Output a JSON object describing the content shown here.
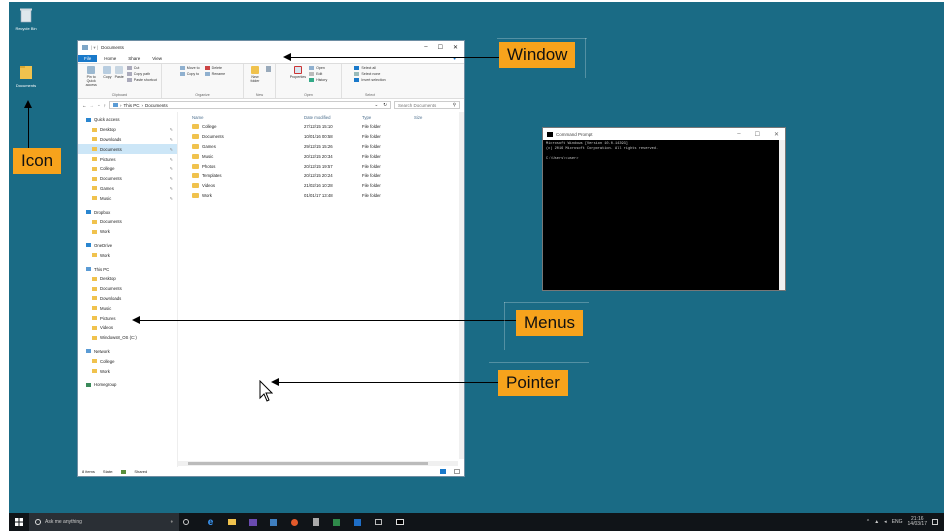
{
  "desktop": {
    "icons": [
      {
        "label": "Recycle Bin",
        "icon": "recycle-bin-icon"
      },
      {
        "label": "Documents",
        "icon": "folder-icon"
      }
    ]
  },
  "callouts": {
    "window": "Window",
    "icon": "Icon",
    "menus": "Menus",
    "pointer": "Pointer"
  },
  "explorer": {
    "title": "Documents",
    "tabs": [
      "File",
      "Home",
      "Share",
      "View"
    ],
    "ribbon": {
      "clipboard": {
        "label": "Clipboard",
        "pin": "Pin to Quick access",
        "copy": "Copy",
        "paste": "Paste",
        "cut": "Cut",
        "copy_path": "Copy path",
        "paste_shortcut": "Paste shortcut"
      },
      "organize": {
        "label": "Organize",
        "move_to": "Move to",
        "delete": "Delete",
        "copy_to": "Copy to",
        "rename": "Rename"
      },
      "new": {
        "label": "New",
        "new_folder": "New folder"
      },
      "open": {
        "label": "Open",
        "properties": "Properties",
        "open": "Open",
        "edit": "Edit",
        "history": "History"
      },
      "select": {
        "label": "Select",
        "select_all": "Select all",
        "select_none": "Select none",
        "invert": "Invert selection"
      }
    },
    "address": {
      "this_pc": "This PC",
      "current": "Documents",
      "search_placeholder": "Search Documents"
    },
    "nav": [
      {
        "label": "Quick access",
        "type": "top"
      },
      {
        "label": "Desktop",
        "pin": true
      },
      {
        "label": "Downloads",
        "pin": true
      },
      {
        "label": "Documents",
        "pin": true,
        "selected": true
      },
      {
        "label": "Pictures",
        "pin": true
      },
      {
        "label": "College",
        "pin": true
      },
      {
        "label": "Documents",
        "pin": true
      },
      {
        "label": "Games",
        "pin": true
      },
      {
        "label": "Music",
        "pin": true
      },
      {
        "label": "Dropbox",
        "type": "top"
      },
      {
        "label": "Documents"
      },
      {
        "label": "Work"
      },
      {
        "label": "OneDrive",
        "type": "top"
      },
      {
        "label": "Work"
      },
      {
        "label": "This PC",
        "type": "top"
      },
      {
        "label": "Desktop"
      },
      {
        "label": "Documents"
      },
      {
        "label": "Downloads"
      },
      {
        "label": "Music"
      },
      {
        "label": "Pictures"
      },
      {
        "label": "Videos"
      },
      {
        "label": "Windows8_OS (C:)"
      },
      {
        "label": "Network",
        "type": "top"
      },
      {
        "label": "College"
      },
      {
        "label": "Work"
      },
      {
        "label": "Homegroup",
        "type": "top"
      }
    ],
    "columns": [
      "Name",
      "Date modified",
      "Type",
      "Size"
    ],
    "files": [
      {
        "name": "College",
        "date": "27/12/15 15:10",
        "type": "File folder"
      },
      {
        "name": "Documents",
        "date": "10/01/16 00:58",
        "type": "File folder"
      },
      {
        "name": "Games",
        "date": "29/12/15 15:26",
        "type": "File folder"
      },
      {
        "name": "Music",
        "date": "20/12/15 20:34",
        "type": "File folder"
      },
      {
        "name": "Photos",
        "date": "20/12/15 19:57",
        "type": "File folder"
      },
      {
        "name": "Templates",
        "date": "20/12/15 20:24",
        "type": "File folder"
      },
      {
        "name": "Videos",
        "date": "21/02/16 10:28",
        "type": "File folder"
      },
      {
        "name": "Work",
        "date": "01/01/17 13:48",
        "type": "File folder"
      }
    ],
    "status": {
      "items": "8 items",
      "state": "State:",
      "shared": "Shared"
    }
  },
  "cmd": {
    "title": "Command Prompt",
    "lines": [
      "Microsoft Windows [Version 10.0.14393]",
      "(c) 2016 Microsoft Corporation. All rights reserved.",
      "",
      "C:\\Users\\<user>"
    ]
  },
  "taskbar": {
    "search": "Ask me anything",
    "lang": "ENG",
    "time": "21:16",
    "date": "14/03/17"
  },
  "colors": {
    "desktop": "#1a6b85",
    "callout": "#f7a31c",
    "accent": "#1979ca"
  }
}
